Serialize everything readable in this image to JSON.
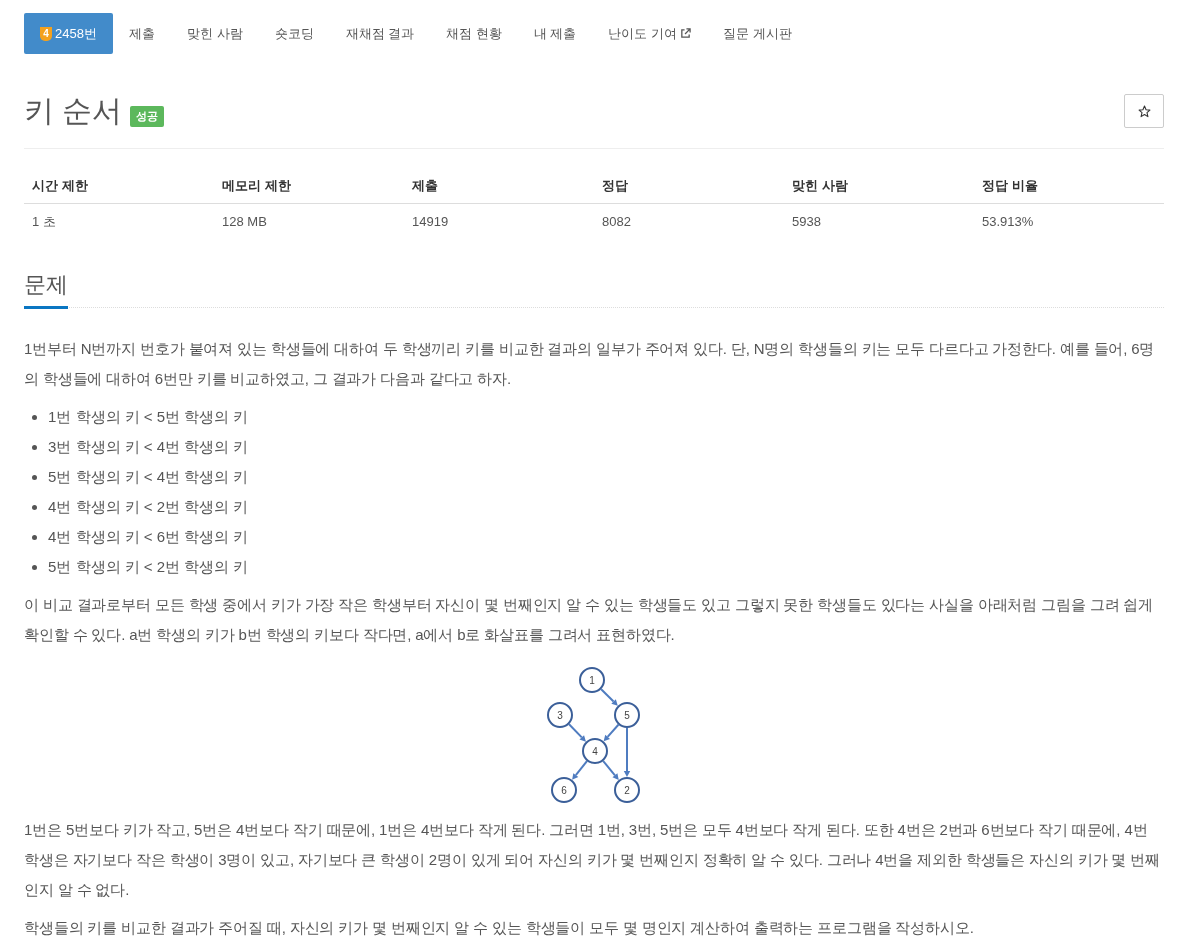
{
  "nav": {
    "tabs": [
      {
        "label": "2458번",
        "tier": "4",
        "selected": true,
        "external": false
      },
      {
        "label": "제출",
        "selected": false,
        "external": false
      },
      {
        "label": "맞힌 사람",
        "selected": false,
        "external": false
      },
      {
        "label": "숏코딩",
        "selected": false,
        "external": false
      },
      {
        "label": "재채점 결과",
        "selected": false,
        "external": false
      },
      {
        "label": "채점 현황",
        "selected": false,
        "external": false
      },
      {
        "label": "내 제출",
        "selected": false,
        "external": false
      },
      {
        "label": "난이도 기여",
        "selected": false,
        "external": true
      },
      {
        "label": "질문 게시판",
        "selected": false,
        "external": false
      }
    ]
  },
  "problem": {
    "title": "키 순서",
    "status": "성공",
    "starred": false
  },
  "stats": {
    "columns": [
      "시간 제한",
      "메모리 제한",
      "제출",
      "정답",
      "맞힌 사람",
      "정답 비율"
    ],
    "rows": [
      [
        "1 초",
        "128 MB",
        "14919",
        "8082",
        "5938",
        "53.913%"
      ]
    ]
  },
  "section": {
    "title": "문제",
    "body": [
      {
        "kind": "paragraph",
        "text": "1번부터 N번까지 번호가 붙여져 있는 학생들에 대하여 두 학생끼리 키를 비교한 결과의 일부가 주어져 있다. 단, N명의 학생들의 키는 모두 다르다고 가정한다. 예를 들어, 6명의 학생들에 대하여 6번만 키를 비교하였고, 그 결과가 다음과 같다고 하자."
      },
      {
        "kind": "list",
        "items": [
          "1번 학생의 키 < 5번 학생의 키",
          "3번 학생의 키 < 4번 학생의 키",
          "5번 학생의 키 < 4번 학생의 키",
          "4번 학생의 키 < 2번 학생의 키",
          "4번 학생의 키 < 6번 학생의 키",
          "5번 학생의 키 < 2번 학생의 키"
        ]
      },
      {
        "kind": "paragraph",
        "text": "이 비교 결과로부터 모든 학생 중에서 키가 가장 작은 학생부터 자신이 몇 번째인지 알 수 있는 학생들도 있고 그렇지 못한 학생들도 있다는 사실을 아래처럼 그림을 그려 쉽게 확인할 수 있다. a번 학생의 키가 b번 학생의 키보다 작다면, a에서 b로 화살표를 그려서 표현하였다."
      },
      {
        "kind": "figure",
        "nodes": [
          "1",
          "3",
          "5",
          "4",
          "6",
          "2"
        ]
      },
      {
        "kind": "paragraph",
        "text": "1번은 5번보다 키가 작고, 5번은 4번보다 작기 때문에, 1번은 4번보다 작게 된다. 그러면 1번, 3번, 5번은 모두 4번보다 작게 된다. 또한 4번은 2번과 6번보다 작기 때문에, 4번 학생은 자기보다 작은 학생이 3명이 있고, 자기보다 큰 학생이 2명이 있게 되어 자신의 키가 몇 번째인지 정확히 알 수 있다. 그러나 4번을 제외한 학생들은 자신의 키가 몇 번째인지 알 수 없다."
      },
      {
        "kind": "paragraph",
        "text": "학생들의 키를 비교한 결과가 주어질 때, 자신의 키가 몇 번째인지 알 수 있는 학생들이 모두 몇 명인지 계산하여 출력하는 프로그램을 작성하시오."
      }
    ]
  }
}
